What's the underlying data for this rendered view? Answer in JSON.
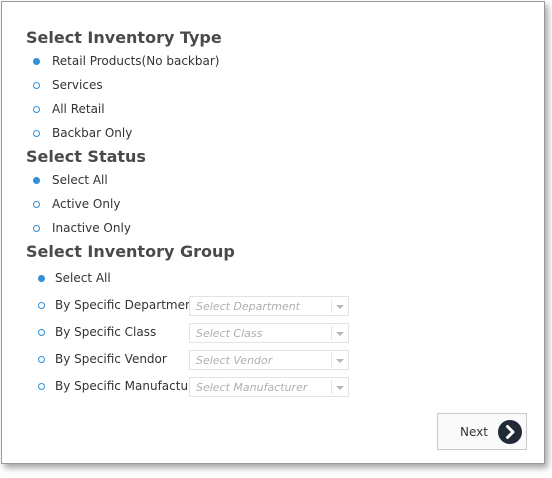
{
  "inventory_type": {
    "title": "Select Inventory Type",
    "options": [
      {
        "label": "Retail Products(No backbar)",
        "selected": true
      },
      {
        "label": "Services",
        "selected": false
      },
      {
        "label": "All Retail",
        "selected": false
      },
      {
        "label": "Backbar Only",
        "selected": false
      }
    ]
  },
  "status": {
    "title": "Select Status",
    "options": [
      {
        "label": "Select All",
        "selected": true
      },
      {
        "label": "Active Only",
        "selected": false
      },
      {
        "label": "Inactive Only",
        "selected": false
      }
    ]
  },
  "inventory_group": {
    "title": "Select Inventory Group",
    "select_all": {
      "label": "Select All",
      "selected": true
    },
    "options": [
      {
        "label": "By Specific Department",
        "selected": false,
        "placeholder": "Select Department"
      },
      {
        "label": "By Specific Class",
        "selected": false,
        "placeholder": "Select Class"
      },
      {
        "label": "By Specific Vendor",
        "selected": false,
        "placeholder": "Select Vendor"
      },
      {
        "label": "By Specific Manufacturer",
        "selected": false,
        "placeholder": "Select Manufacturer"
      }
    ]
  },
  "next_button": {
    "label": "Next",
    "icon": "chevron-right-icon"
  },
  "colors": {
    "radio_accent": "#2f8fd8",
    "next_icon_bg": "#222a35"
  }
}
